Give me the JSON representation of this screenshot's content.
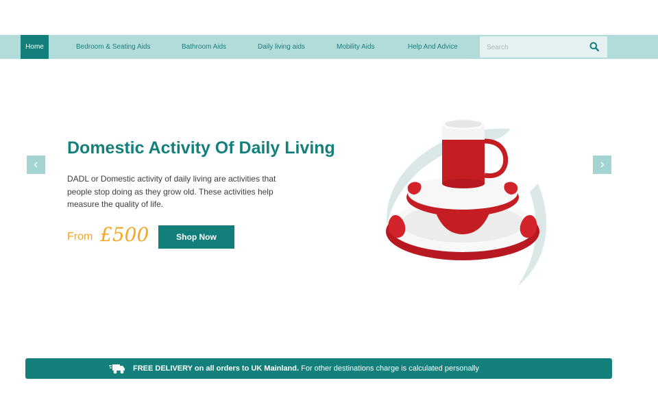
{
  "nav": {
    "items": [
      {
        "label": "Home"
      },
      {
        "label": "Bedroom & Seating Aids"
      },
      {
        "label": "Bathroom Aids"
      },
      {
        "label": "Daily living aids"
      },
      {
        "label": "Mobility Aids"
      },
      {
        "label": "Help And Advice"
      }
    ],
    "search_placeholder": "Search"
  },
  "hero": {
    "title": "Domestic Activity Of Daily Living",
    "description": "DADL or Domestic activity of daily living are activities that people stop doing as they grow old. These activities help measure the quality of life.",
    "price_prefix": "From",
    "price_value": "£500",
    "cta_label": "Shop Now",
    "image_icon": "mug-and-plate-product-image"
  },
  "delivery": {
    "bold_text": "FREE DELIVERY on all orders to UK Mainland.",
    "rest_text": " For other destinations charge is calculated personally",
    "icon": "delivery-truck-icon"
  },
  "colors": {
    "nav_bg": "#b1dcd9",
    "brand_teal": "#127f7a",
    "price_orange": "#f6a623",
    "product_red": "#c41e24"
  }
}
